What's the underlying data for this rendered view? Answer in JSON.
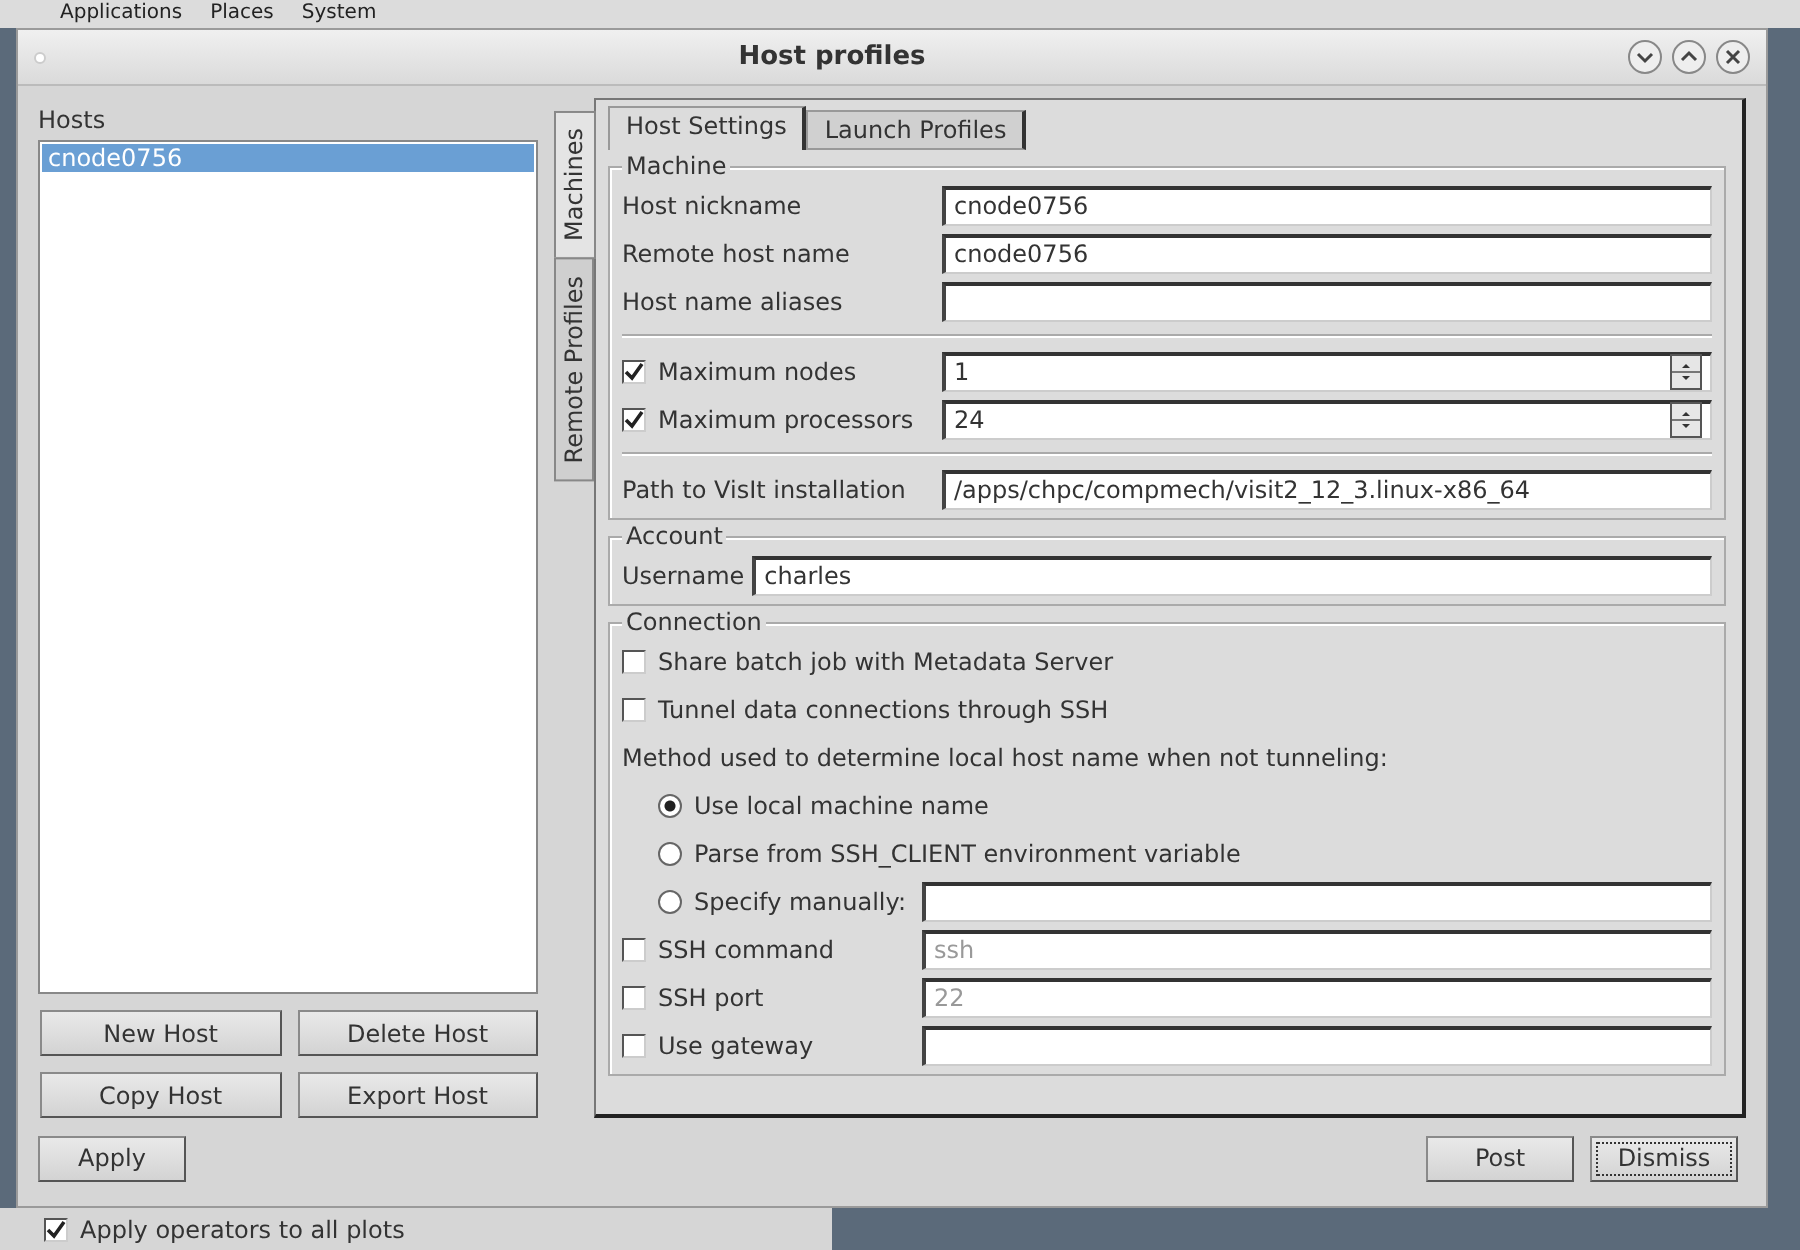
{
  "desktop": {
    "menu": [
      "Applications",
      "Places",
      "System"
    ],
    "background_option": {
      "label": "Apply operators to all plots",
      "checked": true
    }
  },
  "window": {
    "title": "Host profiles"
  },
  "hosts": {
    "label": "Hosts",
    "items": [
      {
        "name": "cnode0756",
        "selected": true
      }
    ],
    "buttons": [
      "New Host",
      "Delete Host",
      "Copy Host",
      "Export Host"
    ]
  },
  "side_tabs": [
    {
      "label": "Machines",
      "selected": true
    },
    {
      "label": "Remote Profiles",
      "selected": false
    }
  ],
  "tabs": [
    {
      "label": "Host Settings",
      "selected": true
    },
    {
      "label": "Launch Profiles",
      "selected": false
    }
  ],
  "machine": {
    "title": "Machine",
    "fields": [
      {
        "label": "Host nickname",
        "value": "cnode0756"
      },
      {
        "label": "Remote host name",
        "value": "cnode0756"
      },
      {
        "label": "Host name aliases"
      }
    ],
    "limits": [
      {
        "label": "Maximum nodes",
        "checked": true,
        "value": "1"
      },
      {
        "label": "Maximum processors",
        "checked": true,
        "value": "24"
      }
    ],
    "path": {
      "label": "Path to VisIt installation",
      "value": "/apps/chpc/compmech/visit2_12_3.linux-x86_64"
    }
  },
  "account": {
    "title": "Account",
    "username": {
      "label": "Username",
      "value": "charles"
    }
  },
  "connection": {
    "title": "Connection",
    "options": [
      {
        "label": "Share batch job with Metadata Server",
        "checked": false
      },
      {
        "label": "Tunnel data connections through SSH",
        "checked": false
      }
    ],
    "method_label": "Method used to determine local host name when not tunneling:",
    "methods": [
      {
        "label": "Use local machine name",
        "selected": true,
        "kind": "plain"
      },
      {
        "label": "Parse from SSH_CLIENT environment variable",
        "selected": false,
        "kind": "plain"
      },
      {
        "label": "Specify manually:",
        "selected": false,
        "kind": "with_field"
      }
    ],
    "ssh": [
      {
        "label": "SSH command",
        "checked": false,
        "value": "ssh"
      },
      {
        "label": "SSH port",
        "checked": false,
        "value": "22"
      },
      {
        "label": "Use gateway",
        "checked": false
      }
    ]
  },
  "footer": {
    "left": [
      "Apply"
    ],
    "right": [
      {
        "label": "Post",
        "focused": false
      },
      {
        "label": "Dismiss",
        "focused": true
      }
    ]
  }
}
